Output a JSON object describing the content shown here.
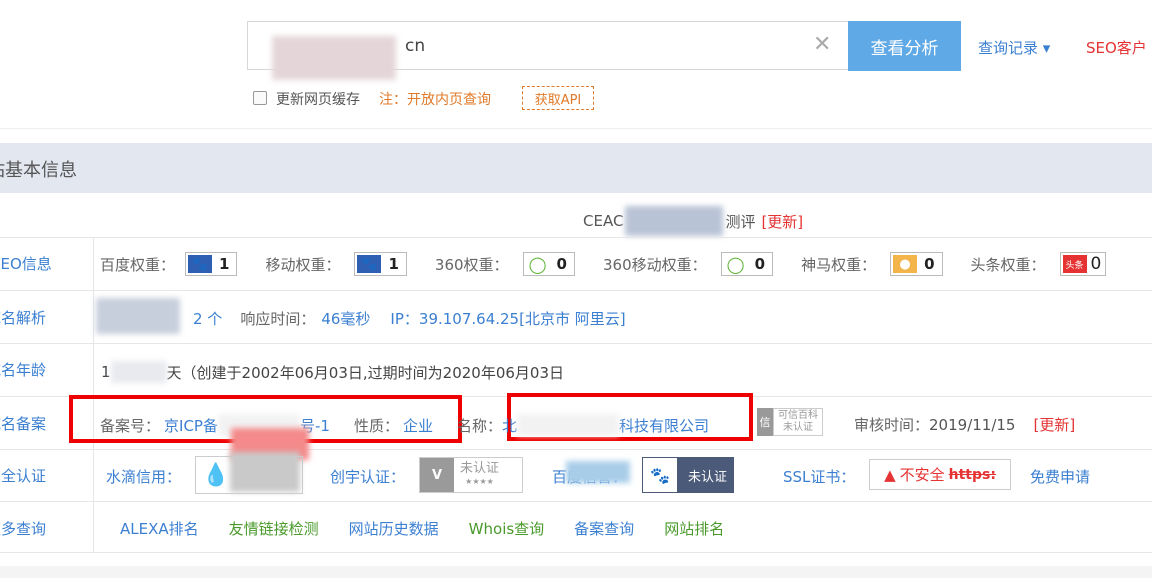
{
  "search": {
    "value": "cn",
    "button_label": "查看分析",
    "query_log_label": "查询记录 ▾",
    "seo_client_label": "SEO客户",
    "cache_label": "更新网页缓存",
    "note_label": "注：开放内页查询",
    "api_label": "获取API"
  },
  "section": {
    "title": "站基本信息"
  },
  "ceac": {
    "prefix": "CEAC",
    "suffix": "测评",
    "update": "[更新]"
  },
  "seo": {
    "label": "SEO信息",
    "items": [
      {
        "label": "百度权重：",
        "value": "1",
        "icon": "paw-icon",
        "color": "#2f5fb3"
      },
      {
        "label": "移动权重：",
        "value": "1",
        "icon": "paw-icon",
        "color": "#2f5fb3"
      },
      {
        "label": "360权重：",
        "value": "0",
        "icon": "360-icon",
        "color": "#5bb431"
      },
      {
        "label": "360移动权重：",
        "value": "0",
        "icon": "360-icon",
        "color": "#5bb431"
      },
      {
        "label": "神马权重：",
        "value": "0",
        "icon": "shenma-icon",
        "color": "#e08a1e"
      },
      {
        "label": "头条权重：",
        "value": "0",
        "icon": "toutiao-icon",
        "color": "#e53333"
      }
    ]
  },
  "dns": {
    "label": "域名解析",
    "count": "2 个",
    "resp_label": "响应时间：",
    "resp_value": "46毫秒",
    "ip_label": "IP：",
    "ip_value": "39.107.64.25[北京市 阿里云]"
  },
  "age": {
    "label": "域名年龄",
    "prefix": "1",
    "text": "天（创建于2002年06月03日,过期时间为2020年06月03日"
  },
  "icp": {
    "label": "域名备案",
    "no_label": "备案号：",
    "no_prefix": "京ICP备",
    "no_suffix": "号-1",
    "nature_label": "性质：",
    "nature_value": "企业",
    "name_label": "名称：",
    "name_prefix": "北",
    "name_suffix": "科技有限公司",
    "baike_label": "可信百科",
    "baike_status": "未认证",
    "review_label": "审核时间：",
    "review_value": "2019/11/15",
    "update": "[更新]"
  },
  "security": {
    "label": "安全认证",
    "shuidi_label": "水滴信用：",
    "chuangyu_label": "创宇认证：",
    "chuangyu_status": "未认证",
    "chuangyu_stars": "★★★★",
    "baidu_label": "百度信誉：",
    "baidu_status": "未认证",
    "ssl_label": "SSL证书：",
    "ssl_status": "不安全",
    "ssl_https": "https:",
    "free_apply": "免费申请"
  },
  "more": {
    "label": "更多查询",
    "links": [
      "ALEXA排名",
      "友情链接检测",
      "网站历史数据",
      "Whois查询",
      "备案查询",
      "网站排名"
    ]
  }
}
